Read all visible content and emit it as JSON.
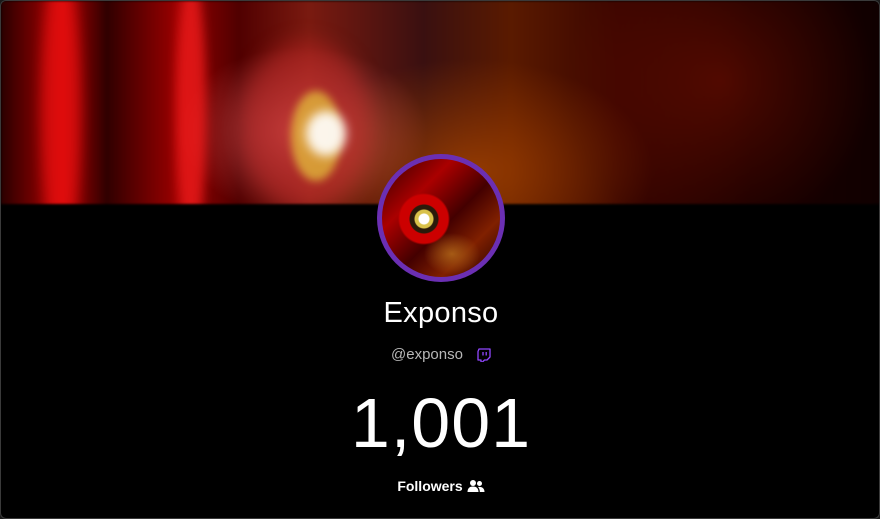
{
  "profile": {
    "display_name": "Exponso",
    "handle": "@exponso",
    "platform_icon": "twitch-icon"
  },
  "stats": {
    "follower_count": "1,001",
    "followers_label": "Followers",
    "followers_icon": "people-icon"
  },
  "colors": {
    "avatar_ring": "#6b2fb3",
    "twitch_accent": "#9146ff",
    "background": "#000000"
  }
}
